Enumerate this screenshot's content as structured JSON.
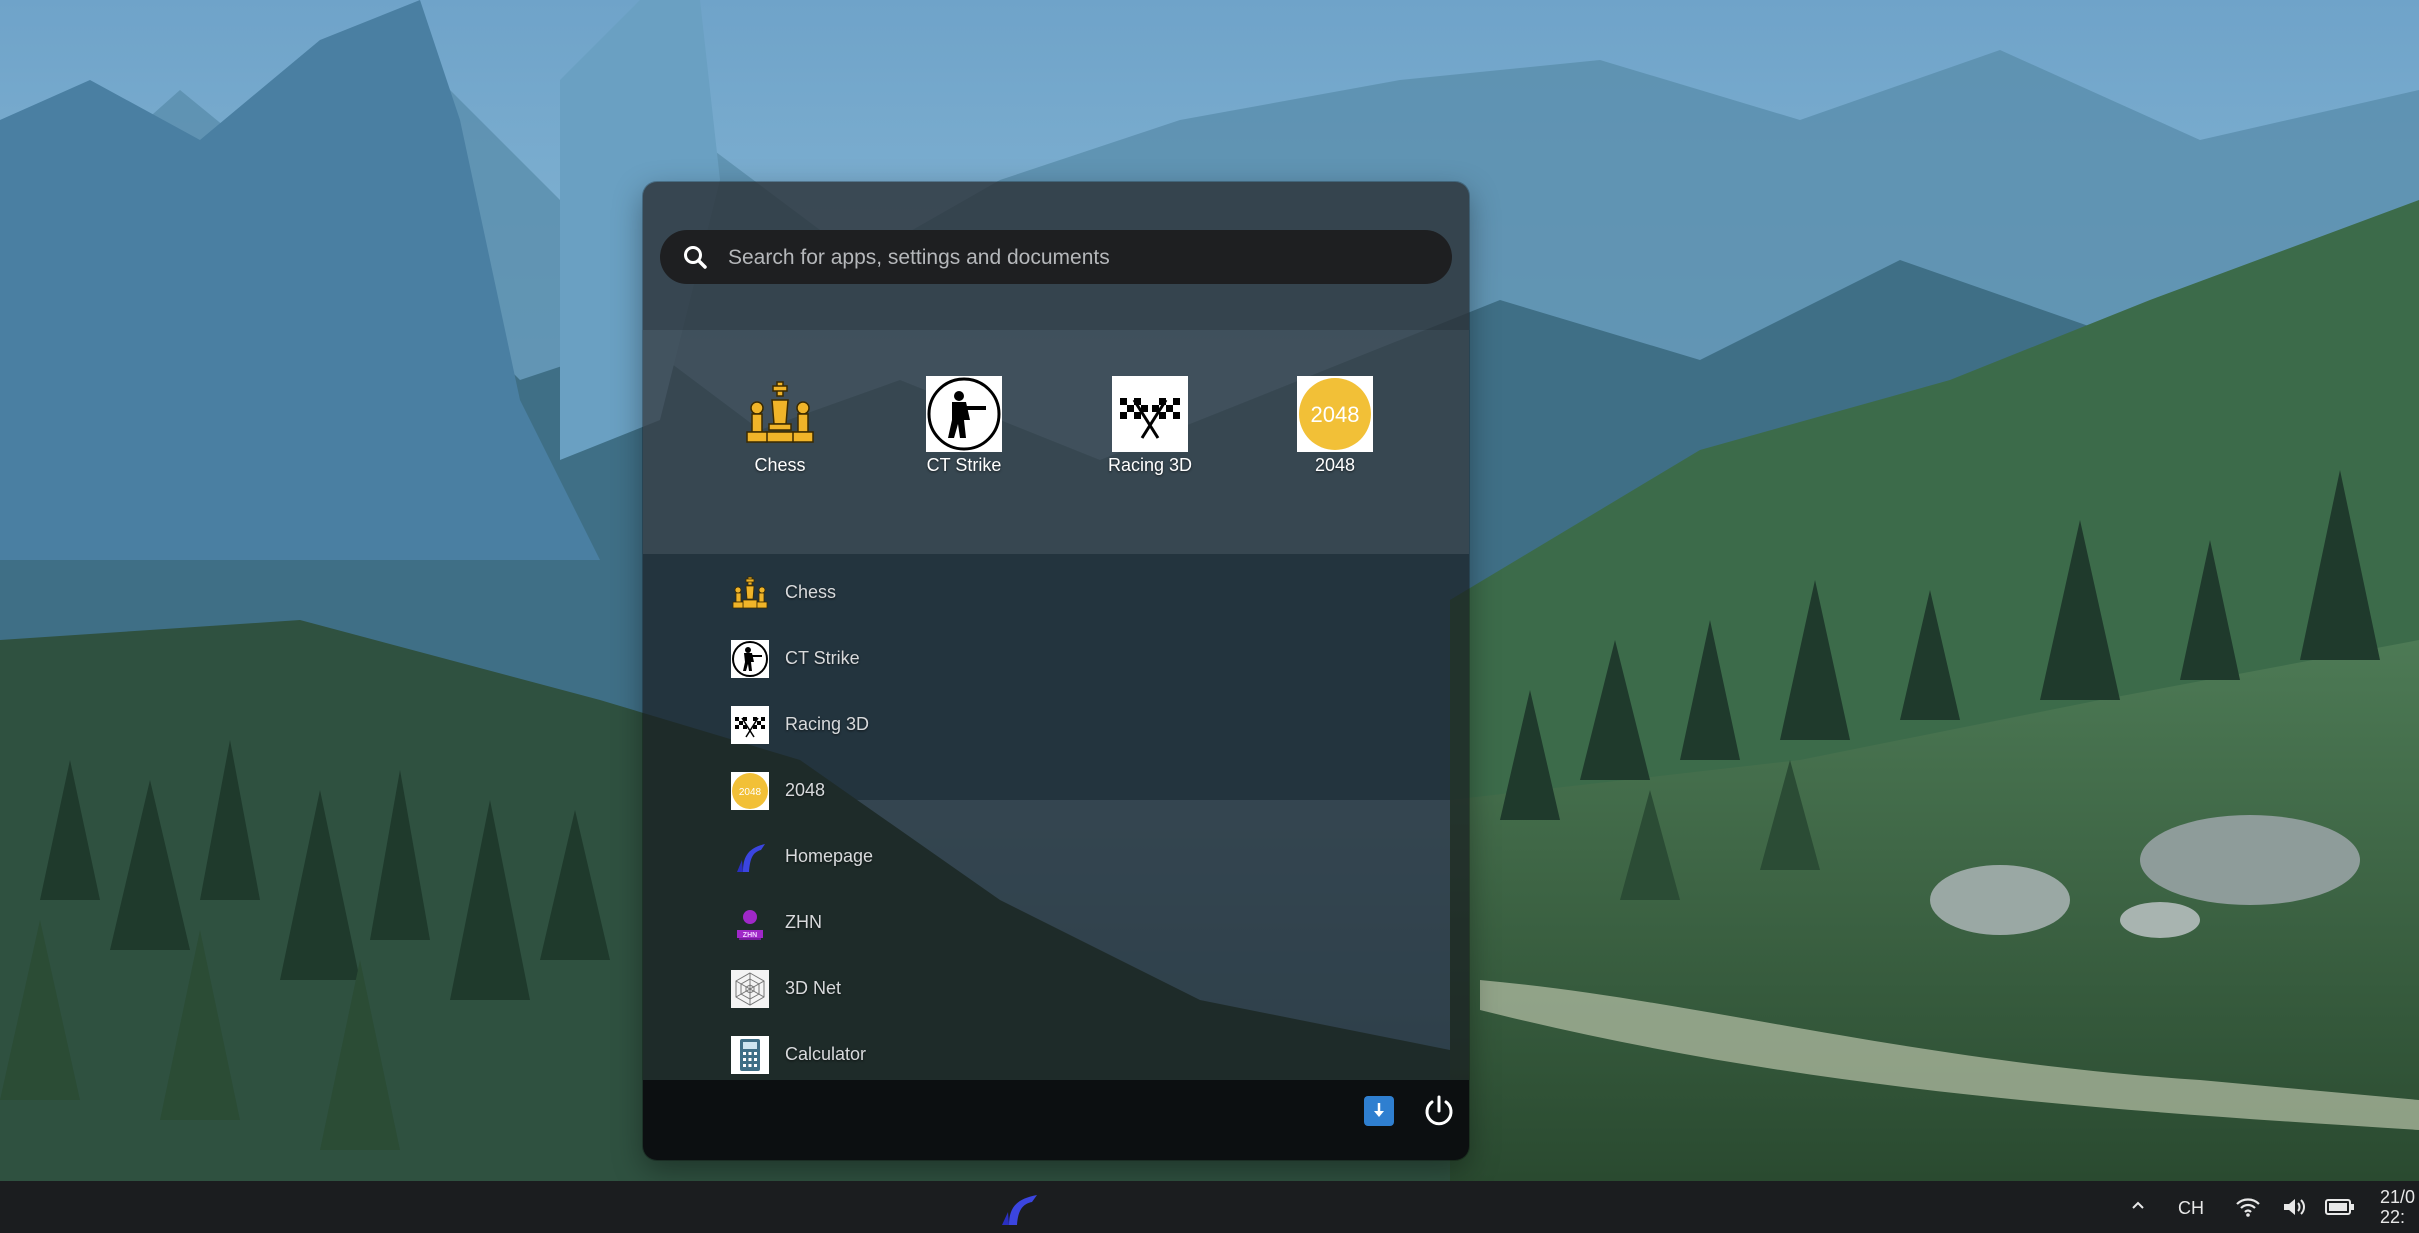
{
  "search": {
    "placeholder": "Search for apps, settings and documents",
    "value": ""
  },
  "pinned": [
    {
      "label": "Chess",
      "icon": "chess-pieces-icon"
    },
    {
      "label": "CT Strike",
      "icon": "ct-strike-soldier-icon"
    },
    {
      "label": "Racing 3D",
      "icon": "checkered-flags-icon"
    },
    {
      "label": "2048",
      "icon": "2048-tile-icon",
      "icon_text": "2048"
    }
  ],
  "apps": [
    {
      "label": "Chess",
      "icon": "chess-pieces-icon"
    },
    {
      "label": "CT Strike",
      "icon": "ct-strike-soldier-icon"
    },
    {
      "label": "Racing 3D",
      "icon": "checkered-flags-icon"
    },
    {
      "label": "2048",
      "icon": "2048-tile-icon",
      "icon_text": "2048"
    },
    {
      "label": "Homepage",
      "icon": "homepage-logo-icon"
    },
    {
      "label": "ZHN",
      "icon": "zhn-logo-icon"
    },
    {
      "label": "3D Net",
      "icon": "3d-net-web-icon"
    },
    {
      "label": "Calculator",
      "icon": "calculator-icon"
    }
  ],
  "footer": {
    "download_icon": "download-icon",
    "power_icon": "power-icon"
  },
  "taskbar": {
    "logo_icon": "os-logo-icon",
    "tray": {
      "chevron_icon": "chevron-up-icon",
      "language": "CH",
      "wifi_icon": "wifi-icon",
      "volume_icon": "volume-icon",
      "battery_icon": "battery-icon",
      "date": "21/0",
      "time": "22:"
    }
  },
  "colors": {
    "accent_blue": "#2f7fd0",
    "logo_blue": "#3b45e0",
    "tile_2048": "#f2c037",
    "chess_gold": "#f0b429",
    "zhn_purple": "#a028c8"
  }
}
